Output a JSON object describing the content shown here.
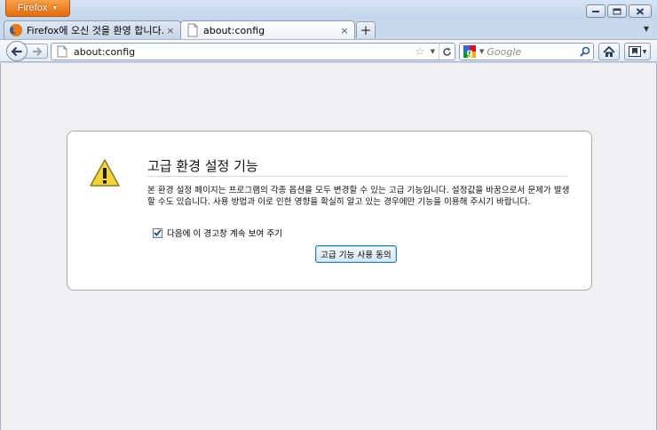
{
  "browser": {
    "app_button_label": "Firefox"
  },
  "tabs": [
    {
      "label": "Firefox에 오신 것을 환영 합니다.",
      "active": false,
      "close_icon": "×"
    },
    {
      "label": "about:config",
      "active": true,
      "close_icon": "×"
    }
  ],
  "toolbar": {
    "newtab_icon": "+",
    "tablist_icon": "▼"
  },
  "navbar": {
    "url": "about:config",
    "bookmark_star": "☆",
    "url_dropmarker": "▼",
    "search_placeholder": "Google",
    "search_engine_dropmarker": "▼"
  },
  "warning": {
    "title": "고급 환경 설정 기능",
    "body": "본 환경 설정 페이지는 프로그램의 각종 옵션을 모두 변경할 수 있는 고급 기능입니다. 설정값을 바꿈으로서 문제가 발생할 수도 있습니다. 사용 방법과 이로 인한 영향을 확실히 알고 있는 경우에만 기능을 이용해 주시기 바랍니다.",
    "show_again_label": "다음에 이 경고창 계속 보여 주기",
    "show_again_checked": true,
    "accept_button_label": "고급 기능 사용 동의"
  },
  "colors": {
    "firefox_button": "#e66b0b",
    "warning_icon": "#f3d33a",
    "accent_border": "#3c7fb1"
  },
  "icons": {
    "back": "back-arrow-icon",
    "forward": "forward-arrow-icon",
    "home": "home-icon",
    "bookmarks": "bookmarks-icon",
    "search": "magnifier-icon",
    "reload": "reload-icon",
    "warning": "warning-triangle-icon"
  }
}
